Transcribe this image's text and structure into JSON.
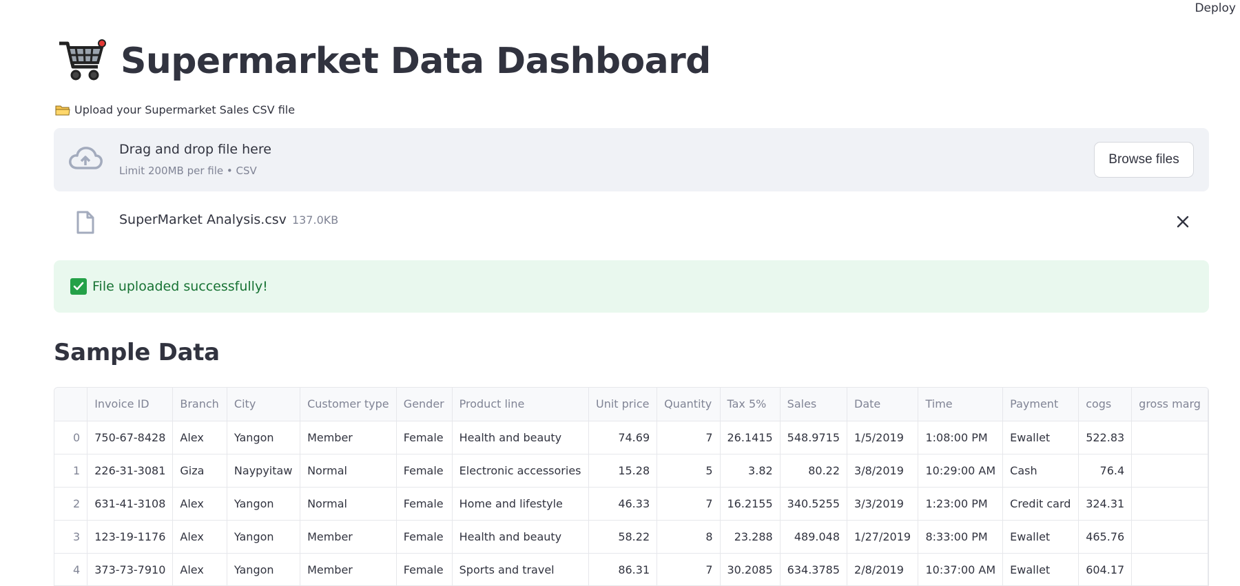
{
  "header": {
    "deploy_label": "Deploy"
  },
  "page": {
    "title": "Supermarket Data Dashboard",
    "upload_label": "Upload your Supermarket Sales CSV file"
  },
  "uploader": {
    "drag_text": "Drag and drop file here",
    "limit_text": "Limit 200MB per file • CSV",
    "browse_label": "Browse files"
  },
  "file": {
    "name": "SuperMarket Analysis.csv",
    "size": "137.0KB"
  },
  "alert": {
    "success_text": "File uploaded successfully!"
  },
  "sample": {
    "title": "Sample Data",
    "columns": [
      "",
      "Invoice ID",
      "Branch",
      "City",
      "Customer type",
      "Gender",
      "Product line",
      "Unit price",
      "Quantity",
      "Tax 5%",
      "Sales",
      "Date",
      "Time",
      "Payment",
      "cogs",
      "gross marg"
    ],
    "rows": [
      [
        "0",
        "750-67-8428",
        "Alex",
        "Yangon",
        "Member",
        "Female",
        "Health and beauty",
        "74.69",
        "7",
        "26.1415",
        "548.9715",
        "1/5/2019",
        "1:08:00 PM",
        "Ewallet",
        "522.83",
        ""
      ],
      [
        "1",
        "226-31-3081",
        "Giza",
        "Naypyitaw",
        "Normal",
        "Female",
        "Electronic accessories",
        "15.28",
        "5",
        "3.82",
        "80.22",
        "3/8/2019",
        "10:29:00 AM",
        "Cash",
        "76.4",
        ""
      ],
      [
        "2",
        "631-41-3108",
        "Alex",
        "Yangon",
        "Normal",
        "Female",
        "Home and lifestyle",
        "46.33",
        "7",
        "16.2155",
        "340.5255",
        "3/3/2019",
        "1:23:00 PM",
        "Credit card",
        "324.31",
        ""
      ],
      [
        "3",
        "123-19-1176",
        "Alex",
        "Yangon",
        "Member",
        "Female",
        "Health and beauty",
        "58.22",
        "8",
        "23.288",
        "489.048",
        "1/27/2019",
        "8:33:00 PM",
        "Ewallet",
        "465.76",
        ""
      ],
      [
        "4",
        "373-73-7910",
        "Alex",
        "Yangon",
        "Member",
        "Female",
        "Sports and travel",
        "86.31",
        "7",
        "30.2085",
        "634.3785",
        "2/8/2019",
        "10:37:00 AM",
        "Ewallet",
        "604.17",
        ""
      ]
    ]
  },
  "colors": {
    "success_bg": "#e9f8ee",
    "success_text": "#177233",
    "dropzone_bg": "#f0f2f6"
  },
  "icons": [
    "shopping-cart-icon",
    "folder-icon",
    "cloud-upload-icon",
    "file-icon",
    "close-icon",
    "check-icon"
  ]
}
